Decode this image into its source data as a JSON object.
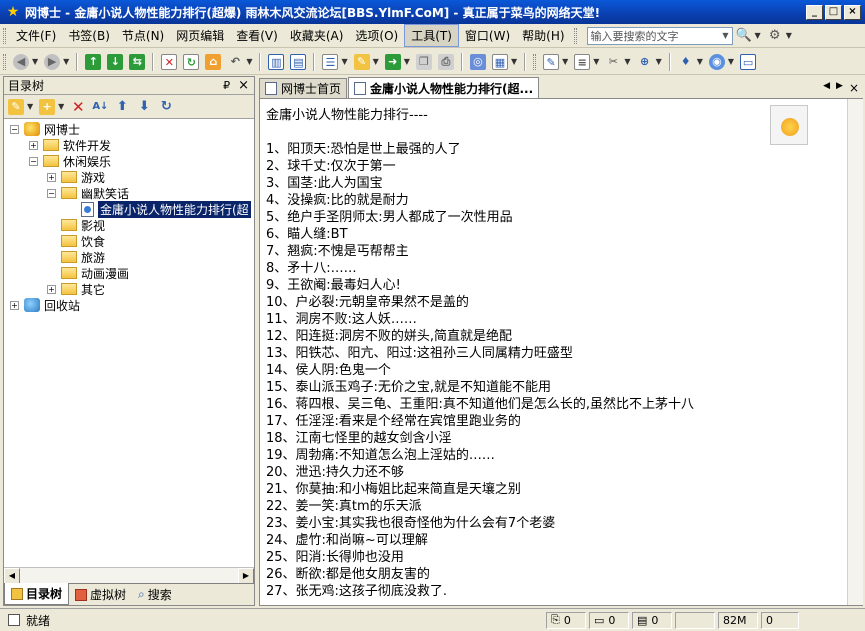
{
  "window": {
    "title": "网博士 - 金庸小说人物性能力排行(超爆) 雨林木风交流论坛[BBS.YlmF.CoM] - 真正属于菜鸟的网络天堂!",
    "minimize": "_",
    "maximize": "□",
    "close": "×"
  },
  "menu": {
    "items": [
      "文件(F)",
      "书签(B)",
      "节点(N)",
      "网页编辑",
      "查看(V)",
      "收藏夹(A)",
      "选项(O)",
      "工具(T)",
      "窗口(W)",
      "帮助(H)"
    ],
    "active_index": 7,
    "search_placeholder": "输入要搜索的文字"
  },
  "toolbar": {
    "icons": [
      "back-icon",
      "forward-icon",
      "up-green-icon",
      "down-green-icon",
      "refresh-green-icon",
      "delete-icon",
      "reload-icon",
      "home-icon",
      "undo-icon",
      "layout-icon",
      "view-icon",
      "folder-open-icon",
      "export-icon",
      "copy-icon",
      "print-icon",
      "settings-icon",
      "grid-icon",
      "edit-icon",
      "note-icon",
      "tools-icon",
      "zoom-icon",
      "paint-icon",
      "globe-icon",
      "window-icon"
    ]
  },
  "left_panel": {
    "title": "目录树",
    "pin": "₽",
    "close": "×",
    "tree": [
      {
        "label": "网博士",
        "level": 0,
        "expander": "−",
        "icon": "root"
      },
      {
        "label": "软件开发",
        "level": 1,
        "expander": "+",
        "icon": "folder"
      },
      {
        "label": "休闲娱乐",
        "level": 1,
        "expander": "−",
        "icon": "folder"
      },
      {
        "label": "游戏",
        "level": 2,
        "expander": "+",
        "icon": "folder"
      },
      {
        "label": "幽默笑话",
        "level": 2,
        "expander": "−",
        "icon": "folder"
      },
      {
        "label": "金庸小说人物性能力排行(超",
        "level": 3,
        "expander": "",
        "icon": "doc",
        "selected": true
      },
      {
        "label": "影视",
        "level": 2,
        "expander": "",
        "icon": "folder"
      },
      {
        "label": "饮食",
        "level": 2,
        "expander": "",
        "icon": "folder"
      },
      {
        "label": "旅游",
        "level": 2,
        "expander": "",
        "icon": "folder"
      },
      {
        "label": "动画漫画",
        "level": 2,
        "expander": "",
        "icon": "folder"
      },
      {
        "label": "其它",
        "level": 2,
        "expander": "+",
        "icon": "folder"
      },
      {
        "label": "回收站",
        "level": 0,
        "expander": "+",
        "icon": "recycle"
      }
    ],
    "bottom_tabs": [
      "目录树",
      "虚拟树",
      "搜索"
    ]
  },
  "doc_tabs": [
    "网博士首页",
    "金庸小说人物性能力排行(超..."
  ],
  "content": {
    "heading": "金庸小说人物性能力排行----",
    "lines": [
      "1、阳顶天:恐怕是世上最强的人了",
      "2、球千丈:仅次于第一",
      "3、国茎:此人为国宝",
      "4、没操疯:比的就是耐力",
      "5、绝户手圣阴师太:男人都成了一次性用品",
      "6、瞄人缝:BT",
      "7、翘疯:不愧是丐帮帮主",
      "8、矛十八:……",
      "9、王欲阉:最毒妇人心!",
      "10、户必裂:元朝皇帝果然不是盖的",
      "11、洞房不败:这人妖……",
      "12、阳连挺:洞房不败的姘头,简直就是绝配",
      "13、阳铁芯、阳亢、阳过:这祖孙三人同属精力旺盛型",
      "14、侯人阴:色鬼一个",
      "15、泰山派玉鸡子:无价之宝,就是不知道能不能用",
      "16、蒋四根、吴三龟、王重阳:真不知道他们是怎么长的,虽然比不上茅十八",
      "17、任淫淫:看来是个经常在宾馆里跑业务的",
      "18、江南七怪里的越女剑含小淫",
      "19、周勃痛:不知道怎么泡上淫姑的……",
      "20、泄迅:持久力还不够",
      "21、你莫抽:和小梅姐比起来简直是天壤之别",
      "22、姜一笑:真tm的乐天派",
      "23、姜小宝:其实我也很奇怪他为什么会有7个老婆",
      "24、虚竹:和尚嘛~可以理解",
      "25、阳消:长得帅也没用",
      "26、断欲:都是他女朋友害的",
      "27、张无鸡:这孩子彻底没救了."
    ]
  },
  "status": {
    "text": "就绪",
    "attachments": "0",
    "files": "0",
    "notes": "0",
    "memory": "82M",
    "count": "0"
  }
}
